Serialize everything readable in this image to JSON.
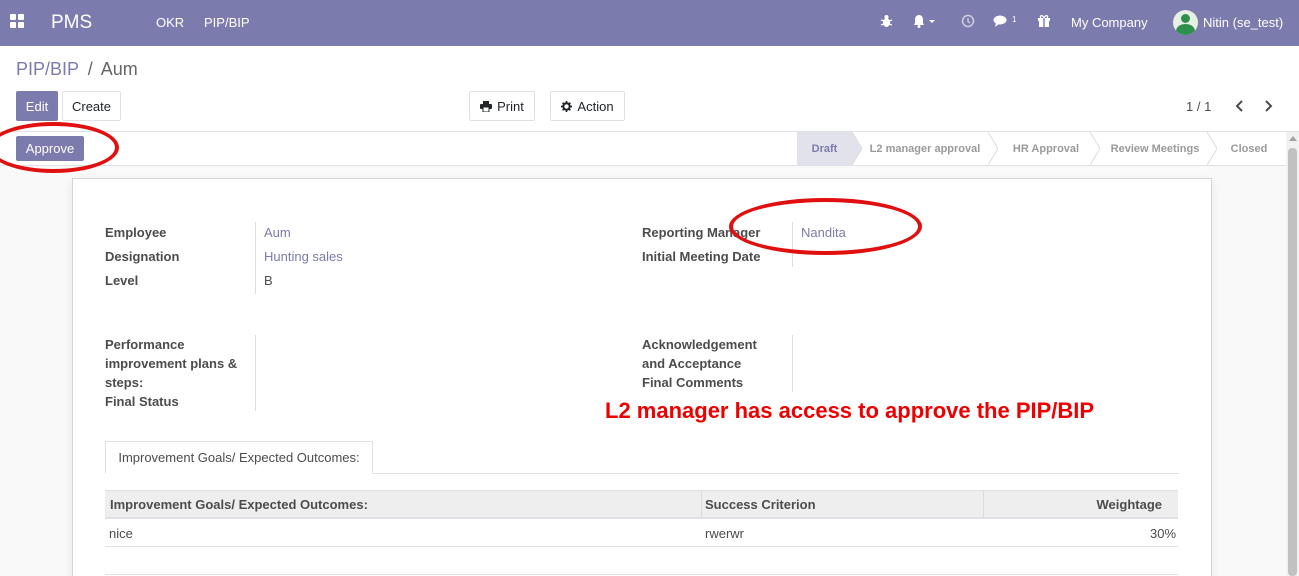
{
  "navbar": {
    "app_name": "PMS",
    "menu": [
      "OKR",
      "PIP/BIP"
    ],
    "chat_count": "1",
    "company": "My Company",
    "user": "Nitin (se_test)",
    "color": "#7c7bad"
  },
  "breadcrumb": {
    "parent": "PIP/BIP",
    "separator": "/",
    "current": "Aum"
  },
  "toolbar": {
    "edit": "Edit",
    "create": "Create",
    "print": "Print",
    "action": "Action",
    "pager": "1 / 1"
  },
  "statusbar": {
    "approve": "Approve",
    "stages": [
      "Draft",
      "L2 manager approval",
      "HR Approval",
      "Review Meetings",
      "Closed"
    ],
    "active_stage": "Draft"
  },
  "form": {
    "employee_label": "Employee",
    "employee": "Aum",
    "designation_label": "Designation",
    "designation": "Hunting sales",
    "level_label": "Level",
    "level": "B",
    "reporting_manager_label": "Reporting Manager",
    "reporting_manager": "Nandita",
    "initial_meeting_label": "Initial Meeting Date",
    "initial_meeting": "",
    "pip_steps_label_1": "Performance",
    "pip_steps_label_2": "improvement plans &",
    "pip_steps_label_3": "steps:",
    "final_status_label": "Final Status",
    "ack_label_1": "Acknowledgement",
    "ack_label_2": "and Acceptance",
    "final_comments_label": "Final Comments"
  },
  "tab": {
    "label": "Improvement Goals/ Expected Outcomes:"
  },
  "table": {
    "headers": [
      "Improvement Goals/ Expected Outcomes:",
      "Success Criterion",
      "Weightage"
    ],
    "rows": [
      {
        "goal": "nice",
        "criterion": "rwerwr",
        "weightage": "30%"
      }
    ]
  },
  "annotation": {
    "text": "L2 manager has access to approve the PIP/BIP"
  }
}
